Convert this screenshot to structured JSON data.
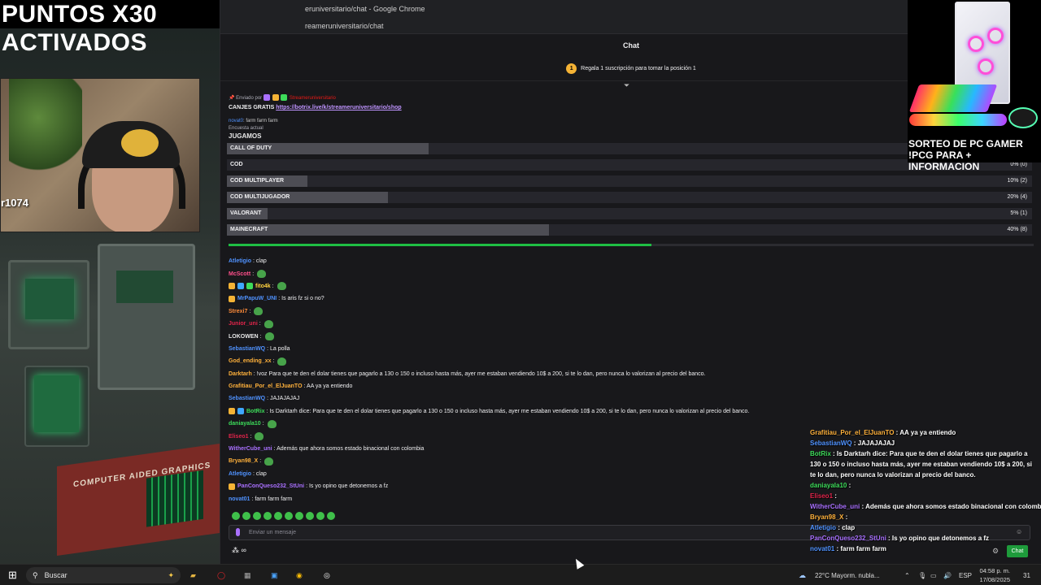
{
  "banner": "PUNTOS X30 ACTIVADOS",
  "webcam_counter": "r1074",
  "scene_book_title": "COMPUTER AIDED GRAPHICS",
  "browser": {
    "window_title": "eruniversitario/chat - Google Chrome",
    "url": "reameruniversitario/chat"
  },
  "chat": {
    "header": "Chat",
    "sub_goal_badge": "1",
    "sub_goal_text": "Regala 1 suscripción para tomar la posición 1",
    "pinned": {
      "sent_by_label": "Enviado por",
      "sender": "Streameruniversitario",
      "prefix": "CANJES GRATIS ",
      "link": "https://botrix.live/k/streameruniversitario/shop"
    },
    "cut_message": {
      "name": "novat0",
      "text": ": farm farm farm"
    },
    "poll": {
      "label": "Encuesta actual",
      "title": "JUGAMOS",
      "progress": 0.525,
      "options": [
        {
          "label": "CALL OF DUTY",
          "pct_text": "",
          "fraction": 0.25
        },
        {
          "label": "COD",
          "pct_text": "0% (0)",
          "fraction": 0.0
        },
        {
          "label": "COD MULTIPLAYER",
          "pct_text": "10% (2)",
          "fraction": 0.1
        },
        {
          "label": "COD MULTIJUGADOR",
          "pct_text": "20% (4)",
          "fraction": 0.2
        },
        {
          "label": "VALORANT",
          "pct_text": "5% (1)",
          "fraction": 0.05
        },
        {
          "label": "MAINECRAFT",
          "pct_text": "40% (8)",
          "fraction": 0.4
        }
      ]
    },
    "messages": [
      {
        "name": "Atletigio",
        "color": "#4f92ff",
        "text": ": clap",
        "emote": false,
        "badges": 0
      },
      {
        "name": "McScott",
        "color": "#ff4f8b",
        "text": ":",
        "emote": true,
        "badges": 0
      },
      {
        "name": "fito4k",
        "color": "#ffd23f",
        "text": ":",
        "emote": true,
        "badges": 3
      },
      {
        "name": "MrPapuW_UNI",
        "color": "#4f92ff",
        "text": ": Is aris fz si o no?",
        "emote": false,
        "badges": 1
      },
      {
        "name": "Strexi7",
        "color": "#ff8c3a",
        "text": ":",
        "emote": true,
        "badges": 0
      },
      {
        "name": "Junior_uni",
        "color": "#e0244a",
        "text": ":",
        "emote": true,
        "badges": 0
      },
      {
        "name": "LOKOWEN",
        "color": "#e8e8e8",
        "text": ":",
        "emote": true,
        "badges": 0
      },
      {
        "name": "SebastianWQ",
        "color": "#4f92ff",
        "text": ": La polla",
        "emote": false,
        "badges": 0
      },
      {
        "name": "God_ending_xx",
        "color": "#ffb13b",
        "text": ":",
        "emote": true,
        "badges": 0
      },
      {
        "name": "Darktarh",
        "color": "#ffb13b",
        "text": ": !voz Para que te den el dolar tienes que pagarlo a 130 o 150 o incluso hasta más, ayer me estaban vendiendo 10$ a 200, si te lo dan, pero nunca lo valorizan al precio del banco.",
        "emote": false,
        "badges": 0
      },
      {
        "name": "Grafitiau_Por_el_ElJuanTO",
        "color": "#ffb13b",
        "text": ": AA ya ya entiendo",
        "emote": false,
        "badges": 0
      },
      {
        "name": "SebastianWQ",
        "color": "#4f92ff",
        "text": ": JAJAJAJAJ",
        "emote": false,
        "badges": 0
      },
      {
        "name": "BotRix",
        "color": "#3ddc5a",
        "text": ": Is Darktarh dice: Para que te den el dolar tienes que pagarlo a 130 o 150 o incluso hasta más, ayer me estaban vendiendo 10$ a 200, si te lo dan, pero nunca lo valorizan al precio del banco.",
        "emote": false,
        "badges": 2
      },
      {
        "name": "daniayala10",
        "color": "#3ddc5a",
        "text": ":",
        "emote": true,
        "badges": 0
      },
      {
        "name": "Eliseo1",
        "color": "#e0244a",
        "text": ":",
        "emote": true,
        "badges": 0
      },
      {
        "name": "WitherCube_uni",
        "color": "#a970ff",
        "text": ": Además que ahora somos estado binacional con colombia",
        "emote": false,
        "badges": 0
      },
      {
        "name": "Bryan98_X",
        "color": "#ffb13b",
        "text": ":",
        "emote": true,
        "badges": 0
      },
      {
        "name": "Atletigio",
        "color": "#4f92ff",
        "text": ": clap",
        "emote": false,
        "badges": 0
      },
      {
        "name": "PanConQueso232_StUni",
        "color": "#a970ff",
        "text": ": Is yo opino que detonemos a fz",
        "emote": false,
        "badges": 1
      },
      {
        "name": "novat01",
        "color": "#4f92ff",
        "text": ": farm farm farm",
        "emote": false,
        "badges": 0
      }
    ],
    "input_placeholder": "Enviar un mensaje",
    "points_label": "∞"
  },
  "overlay": {
    "lines": [
      {
        "name": "Grafitiau_Por_el_ElJuanTO",
        "color": "#ffb13b",
        "text": " : AA ya ya entiendo"
      },
      {
        "name": "SebastianWQ",
        "color": "#4f92ff",
        "text": " : JAJAJAJAJ"
      },
      {
        "name": "BotRix",
        "color": "#3ddc5a",
        "text": " : Is Darktarh dice: Para que te den el dolar tienes que pagarlo a 130 o 150 o incluso hasta más, ayer me estaban vendiendo 10$ a 200, si te lo dan, pero nunca lo valorizan al precio del banco."
      },
      {
        "name": "daniayala10",
        "color": "#3ddc5a",
        "text": " :"
      },
      {
        "name": "Eliseo1",
        "color": "#e0244a",
        "text": " :"
      },
      {
        "name": "WitherCube_uni",
        "color": "#a970ff",
        "text": " : Además que ahora somos estado binacional con colombia"
      },
      {
        "name": "Bryan98_X",
        "color": "#ffb13b",
        "text": " :"
      },
      {
        "name": "Atletigio",
        "color": "#4f92ff",
        "text": " : clap"
      },
      {
        "name": "PanConQueso232_StUni",
        "color": "#a970ff",
        "text": " : Is yo opino que detonemos a fz"
      },
      {
        "name": "novat01",
        "color": "#4f92ff",
        "text": " : farm farm farm"
      }
    ],
    "chat_button": "Chat"
  },
  "promo": {
    "line1": "SORTEO DE PC GAMER",
    "line2": "!PCG PARA + INFORMACION"
  },
  "taskbar": {
    "search": "Buscar",
    "weather": "22°C  Mayorm. nubla...",
    "language": "ESP",
    "time": "04:58 p. m.",
    "date": "17/08/2025",
    "notifications": "31"
  }
}
